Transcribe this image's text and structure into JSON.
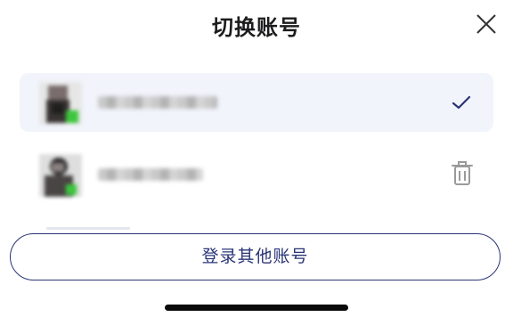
{
  "header": {
    "title": "切换账号",
    "close_icon": "close-icon"
  },
  "accounts": [
    {
      "selected": true,
      "name_visible": false,
      "status_icon": "checkmark-icon",
      "status_color": "#2a3476"
    },
    {
      "selected": false,
      "name_visible": false,
      "status_icon": "trash-icon",
      "status_color": "#9a9a9a"
    }
  ],
  "actions": {
    "login_other_label": "登录其他账号"
  },
  "colors": {
    "accent": "#2a3476",
    "selected_row_bg": "#f1f4fb",
    "avatar_badge": "#3cc63c"
  }
}
